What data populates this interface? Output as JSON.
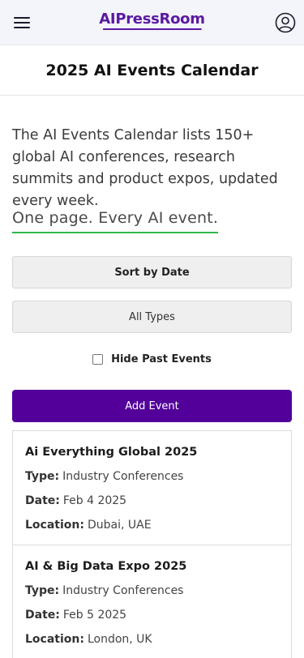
{
  "header": {
    "logo_text": "AIPressRoom",
    "menu_icon": "hamburger-icon",
    "user_icon": "user-circle-icon",
    "brand_color": "#520099"
  },
  "page": {
    "title": "2025 AI Events Calendar",
    "intro": "The AI Events Calendar lists 150+ global AI conferences, research summits and product expos, updated every week.",
    "tagline": "One page. Every AI event."
  },
  "controls": {
    "sort_label": "Sort by Date",
    "types_label": "All Types",
    "hide_past_label": "Hide Past Events",
    "hide_past_checked": false,
    "add_event_label": "Add Event"
  },
  "field_labels": {
    "type": "Type:",
    "date": "Date:",
    "location": "Location:"
  },
  "events": [
    {
      "name": "Ai Everything Global 2025",
      "type": "Industry Conferences",
      "date": "Feb 4 2025",
      "location": "Dubai, UAE"
    },
    {
      "name": "AI & Big Data Expo 2025",
      "type": "Industry Conferences",
      "date": "Feb 5 2025",
      "location": "London, UK"
    }
  ]
}
